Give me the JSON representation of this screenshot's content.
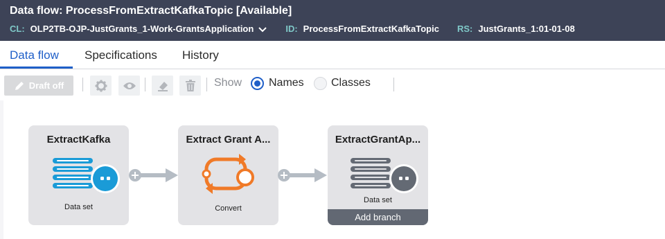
{
  "header": {
    "title": "Data flow: ProcessFromExtractKafkaTopic [Available]",
    "cl_label": "CL:",
    "cl_value": "OLP2TB-OJP-JustGrants_1-Work-GrantsApplication",
    "id_label": "ID:",
    "id_value": "ProcessFromExtractKafkaTopic",
    "rs_label": "RS:",
    "rs_value": "JustGrants_1:01-01-08"
  },
  "tabs": [
    {
      "label": "Data flow",
      "active": true
    },
    {
      "label": "Specifications",
      "active": false
    },
    {
      "label": "History",
      "active": false
    }
  ],
  "toolbar": {
    "draft_label": "Draft off",
    "show_label": "Show",
    "radio_names": "Names",
    "radio_classes": "Classes",
    "selected": "Names",
    "icons": [
      "gear-icon",
      "eye-icon",
      "eraser-icon",
      "trash-icon"
    ]
  },
  "shapes": [
    {
      "name": "ExtractKafka",
      "type": "Data set",
      "icon": "dataset-icon",
      "color": "#1a9bd7"
    },
    {
      "name": "Extract Grant A...",
      "type": "Convert",
      "icon": "convert-icon",
      "color": "#f07a28"
    },
    {
      "name": "ExtractGrantAp...",
      "type": "Data set",
      "icon": "dataset-icon",
      "color": "#646a74",
      "action": "Add branch"
    }
  ],
  "colors": {
    "header_bg": "#3d4357",
    "meta_key": "#7fc8c8",
    "accent": "#1f5fc8",
    "connector": "#b5bcc4"
  }
}
